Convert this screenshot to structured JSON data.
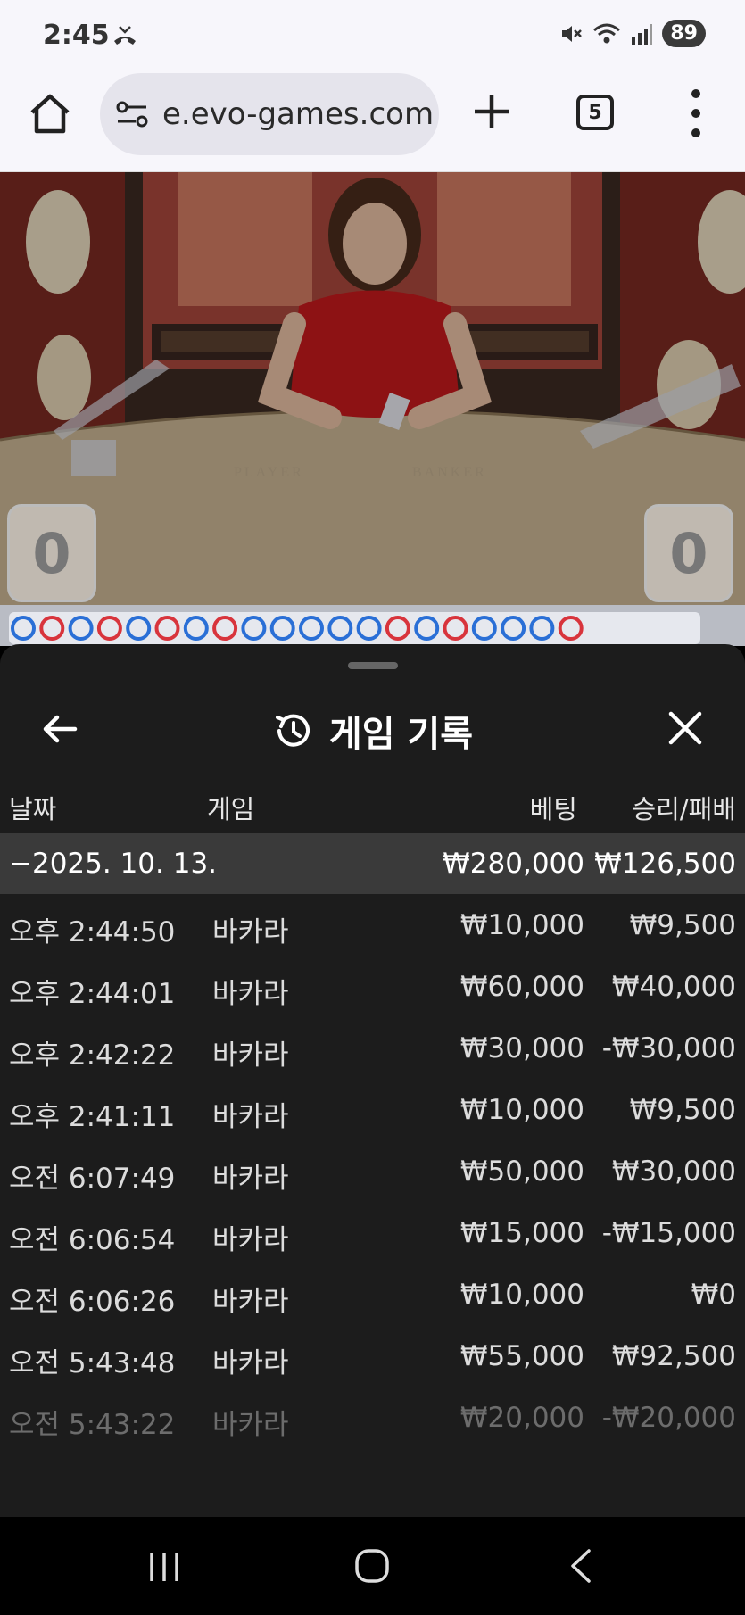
{
  "status_bar": {
    "time": "2:45",
    "battery": "89",
    "icons": [
      "missed-call-icon",
      "mute-icon",
      "wifi-icon",
      "signal-icon",
      "battery-icon"
    ]
  },
  "browser": {
    "url": "e.evo-games.com",
    "tab_count": "5",
    "icons": [
      "home-icon",
      "site-settings-icon",
      "plus-icon",
      "tabs-icon",
      "more-vert-icon"
    ]
  },
  "game": {
    "player_score": "0",
    "banker_score": "0",
    "table_player_label": "PLAYER",
    "table_banker_label": "BANKER",
    "road_marks": [
      "B",
      "R",
      "B",
      "R",
      "B",
      "R",
      "B",
      "R",
      "B",
      "B",
      "B",
      "B",
      "B",
      "R",
      "B",
      "R",
      "B",
      "B",
      "B",
      "R"
    ],
    "colors": {
      "player_blue": "#2a6fd6",
      "banker_red": "#d8343c"
    }
  },
  "panel": {
    "title": "게임 기록",
    "columns": {
      "date": "날짜",
      "game": "게임",
      "bet": "베팅",
      "result": "승리/패배"
    },
    "date_group": {
      "date": "−2025. 10. 13.",
      "bet_total": "₩280,000",
      "result_total": "₩126,500"
    },
    "rows": [
      {
        "time": "오후 2:44:50",
        "game": "바카라",
        "bet": "₩10,000",
        "result": "₩9,500"
      },
      {
        "time": "오후 2:44:01",
        "game": "바카라",
        "bet": "₩60,000",
        "result": "₩40,000"
      },
      {
        "time": "오후 2:42:22",
        "game": "바카라",
        "bet": "₩30,000",
        "result": "-₩30,000"
      },
      {
        "time": "오후 2:41:11",
        "game": "바카라",
        "bet": "₩10,000",
        "result": "₩9,500"
      },
      {
        "time": "오전 6:07:49",
        "game": "바카라",
        "bet": "₩50,000",
        "result": "₩30,000"
      },
      {
        "time": "오전 6:06:54",
        "game": "바카라",
        "bet": "₩15,000",
        "result": "-₩15,000"
      },
      {
        "time": "오전 6:06:26",
        "game": "바카라",
        "bet": "₩10,000",
        "result": "₩0"
      },
      {
        "time": "오전 5:43:48",
        "game": "바카라",
        "bet": "₩55,000",
        "result": "₩92,500"
      },
      {
        "time": "오전 5:43:22",
        "game": "바카라",
        "bet": "₩20,000",
        "result": "-₩20,000"
      }
    ],
    "icons": [
      "back-arrow-icon",
      "history-icon",
      "close-icon"
    ]
  }
}
